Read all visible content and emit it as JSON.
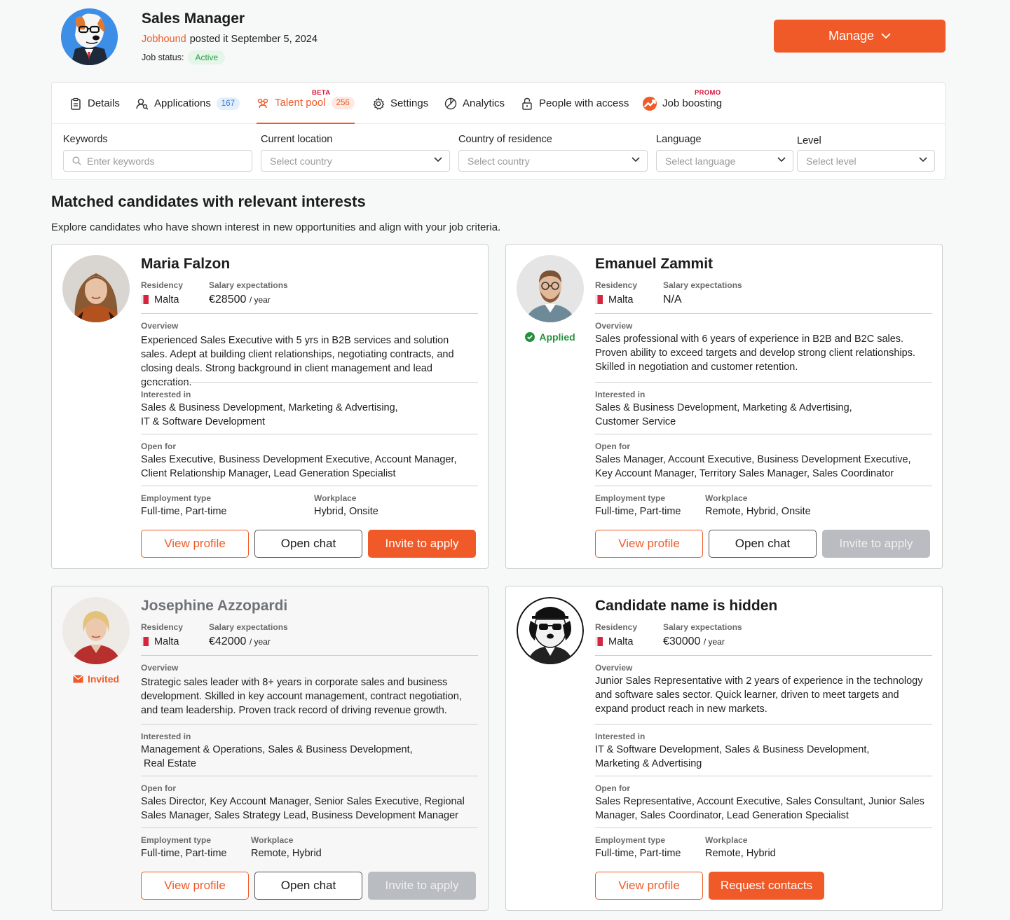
{
  "header": {
    "job_title": "Sales Manager",
    "company": "Jobhound",
    "posted_text": "posted it September 5, 2024",
    "status_label": "Job status:",
    "status_value": "Active",
    "manage_label": "Manage"
  },
  "tabs": [
    {
      "label": "Details",
      "icon": "clipboard-icon"
    },
    {
      "label": "Applications",
      "count": "167",
      "icon": "user-search-icon"
    },
    {
      "label": "Talent pool",
      "count": "256",
      "badge": "BETA",
      "icon": "people-icon",
      "active": true
    },
    {
      "label": "Settings",
      "icon": "gear-icon"
    },
    {
      "label": "Analytics",
      "icon": "pie-chart-icon"
    },
    {
      "label": "People with access",
      "icon": "lock-icon"
    },
    {
      "label": "Job boosting",
      "badge": "PROMO",
      "icon": "boost-icon"
    }
  ],
  "filters": {
    "keywords": {
      "label": "Keywords",
      "placeholder": "Enter keywords"
    },
    "current_location": {
      "label": "Current location",
      "placeholder": "Select country"
    },
    "country_of_residence": {
      "label": "Country of residence",
      "placeholder": "Select country"
    },
    "language": {
      "label": "Language",
      "placeholder": "Select language"
    },
    "level": {
      "label": "Level",
      "placeholder": "Select level"
    }
  },
  "section": {
    "title": "Matched candidates with relevant interests",
    "subtitle": "Explore candidates who have shown interest in new opportunities and align with your job criteria."
  },
  "labels": {
    "residency": "Residency",
    "salary": "Salary expectations",
    "per_year": "/ year",
    "overview": "Overview",
    "interested_in": "Interested in",
    "open_for": "Open for",
    "employment_type": "Employment type",
    "workplace": "Workplace"
  },
  "candidates": [
    {
      "name": "Maria Falzon",
      "residency": "Malta",
      "salary": "€28500",
      "overview": "Experienced Sales Executive with 5 yrs in B2B services and solution sales. Adept at building client relationships, negotiating contracts, and closing deals. Strong background in client management and lead generation.",
      "interested_in_1": "Sales & Business Development, Marketing & Advertising,",
      "interested_in_2": "IT & Software Development",
      "open_for_1": "Sales Executive, Business Development Executive, Account Manager,",
      "open_for_2": "Client Relationship Manager, Lead Generation Specialist",
      "employment_type": "Full-time, Part-time",
      "workplace": "Hybrid, Onsite",
      "buttons": [
        "View profile",
        "Open chat",
        "Invite to apply"
      ]
    },
    {
      "name": "Emanuel Zammit",
      "residency": "Malta",
      "salary": "N/A",
      "status": "Applied",
      "overview": "Sales professional with 6 years of experience in B2B and B2C sales. Proven ability to exceed targets and develop strong client relationships. Skilled in negotiation and customer retention.",
      "interested_in_1": "Sales & Business Development, Marketing & Advertising,",
      "interested_in_2": "Customer Service",
      "open_for_1": "Sales Manager, Account Executive, Business Development Executive,",
      "open_for_2": "Key Account Manager, Territory Sales Manager, Sales Coordinator",
      "employment_type": "Full-time, Part-time",
      "workplace": "Remote, Hybrid, Onsite",
      "buttons": [
        "View profile",
        "Open chat",
        "Invite to apply"
      ]
    },
    {
      "name": "Josephine Azzopardi",
      "residency": "Malta",
      "salary": "€42000",
      "status": "Invited",
      "overview": "Strategic sales leader with 8+ years in corporate sales and business development. Skilled in key account management, contract negotiation, and team leadership. Proven track record of driving revenue growth.",
      "interested_in_1": "Management & Operations, Sales & Business Development,",
      "interested_in_2": " Real Estate",
      "open_for_1": "Sales Director, Key Account Manager, Senior Sales Executive, Regional",
      "open_for_2": "Sales Manager, Sales Strategy Lead, Business Development Manager",
      "employment_type": "Full-time, Part-time",
      "workplace": "Remote, Hybrid",
      "buttons": [
        "View profile",
        "Open chat",
        "Invite to apply"
      ]
    },
    {
      "name": "Candidate name is hidden",
      "residency": "Malta",
      "salary": "€30000",
      "overview": "Junior Sales Representative with 2 years of experience in the technology and software sales sector. Quick learner, driven to meet targets and expand product reach in new markets.",
      "interested_in_1": "IT & Software Development, Sales & Business Development,",
      "interested_in_2": "Marketing & Advertising",
      "open_for_1": "Sales Representative, Account Executive, Sales Consultant, Junior Sales",
      "open_for_2": "Manager, Sales Coordinator, Lead Generation Specialist",
      "employment_type": "Full-time, Part-time",
      "workplace": "Remote, Hybrid",
      "buttons": [
        "View profile",
        "Request contacts"
      ]
    }
  ],
  "colors": {
    "accent": "#f05a28",
    "success": "#25913d",
    "disabled": "#b9bcc0"
  }
}
